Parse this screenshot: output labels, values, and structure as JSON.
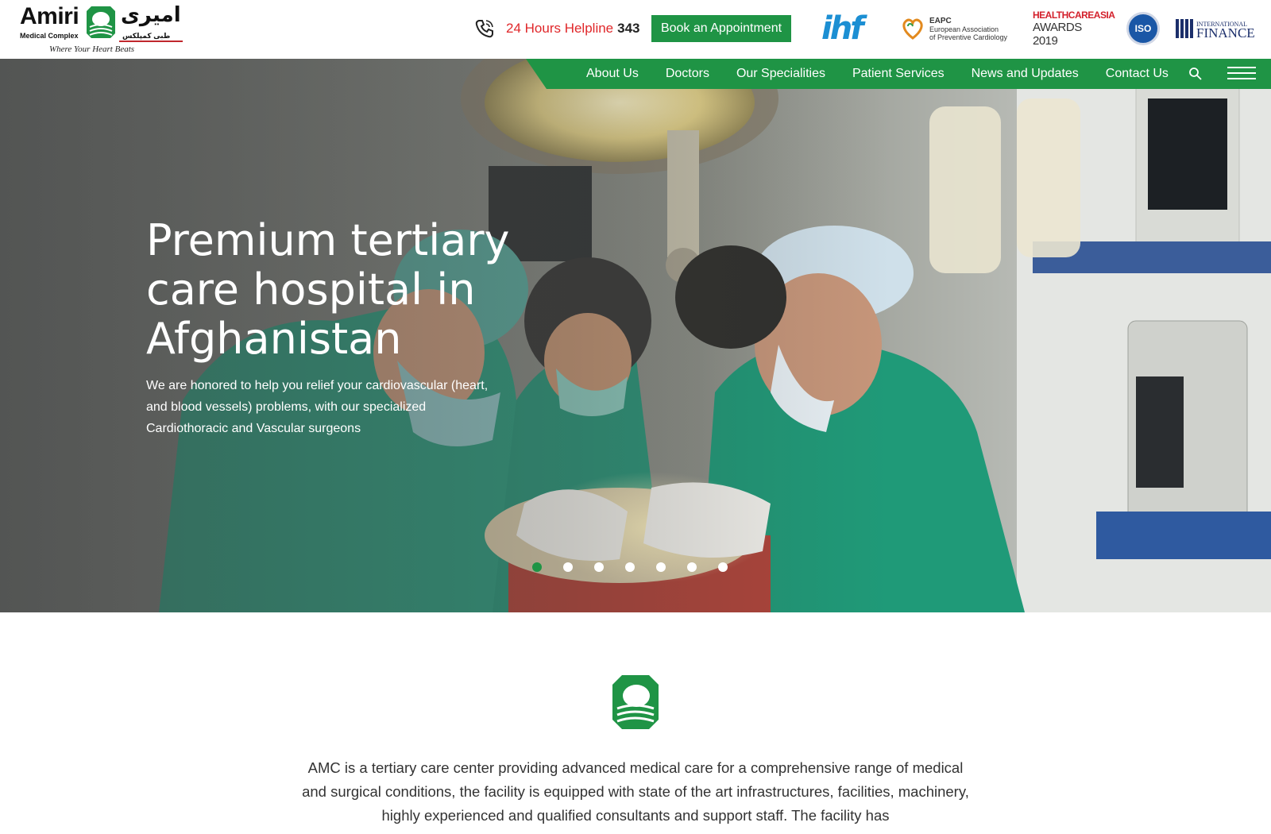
{
  "brand": {
    "name_en": "Amiri",
    "sub_en": "Medical Complex",
    "name_ar": "امیری",
    "sub_ar": "طبی کمپلکس",
    "tagline": "Where Your Heart Beats",
    "green": "#1f9445",
    "red": "#e0272a"
  },
  "header": {
    "helpline_label": "24 Hours Helpline",
    "helpline_number": "343",
    "book_button": "Book an Appointment",
    "partners": {
      "ihf": "ihf",
      "eapc_abbr": "EAPC",
      "eapc_line1": "European Association",
      "eapc_line2": "of Preventive Cardiology",
      "hca_top": "HEALTHCAREASIA",
      "hca_bottom": "AWARDS 2019",
      "iso": "ISO",
      "if_small": "INTERNATIONAL",
      "if_large": "FINANCE"
    }
  },
  "nav": {
    "items": [
      {
        "label": "About Us"
      },
      {
        "label": "Doctors"
      },
      {
        "label": "Our Specialities"
      },
      {
        "label": "Patient Services"
      },
      {
        "label": "News and Updates"
      },
      {
        "label": "Contact Us"
      }
    ],
    "search_icon": "search-icon",
    "menu_icon": "hamburger-menu-icon"
  },
  "hero": {
    "title": "Premium tertiary care hospital in Afghanistan",
    "description": "We are honored to help you relief your cardiovascular (heart, and blood vessels) problems, with our specialized Cardiothoracic and Vascular surgeons",
    "slide_count": 7,
    "active_slide": 1
  },
  "about": {
    "text": "AMC is a tertiary care center providing advanced medical care for a comprehensive range of medical and surgical conditions, the facility is equipped with state of the art infrastructures, facilities, machinery, highly experienced and qualified consultants and support staff. The facility has"
  }
}
